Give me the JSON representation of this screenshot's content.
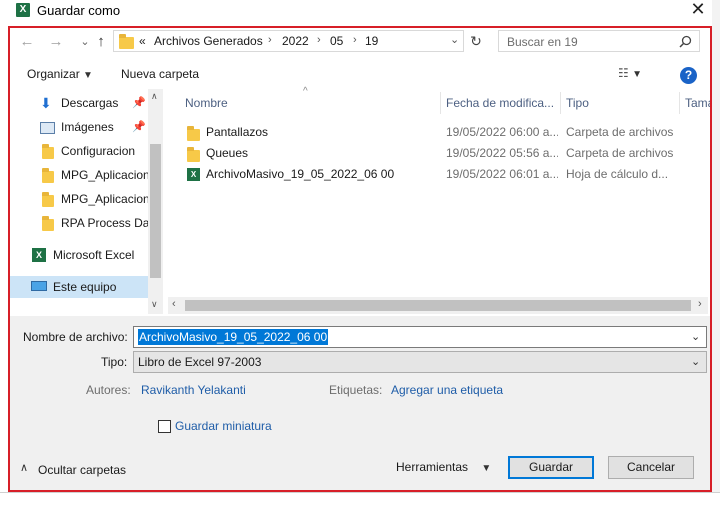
{
  "window": {
    "title": "Guardar como",
    "app_badge": "X",
    "close_icon": "close-icon"
  },
  "address": {
    "overflow": "«",
    "crumbs": [
      "Archivos Generados",
      "2022",
      "05",
      "19"
    ],
    "search_placeholder": "Buscar en 19"
  },
  "toolbar": {
    "organize": "Organizar",
    "new_folder": "Nueva carpeta",
    "help": "?"
  },
  "nav": {
    "items": [
      {
        "label": "Descargas",
        "icon": "download-icon",
        "pinned": true
      },
      {
        "label": "Imágenes",
        "icon": "pictures-icon",
        "pinned": true
      },
      {
        "label": "Configuracion",
        "icon": "folder-icon",
        "pinned": false
      },
      {
        "label": "MPG_Aplicacion",
        "icon": "folder-icon",
        "pinned": false
      },
      {
        "label": "MPG_Aplicacion",
        "icon": "folder-icon",
        "pinned": false
      },
      {
        "label": "RPA Process Dat",
        "icon": "folder-icon",
        "pinned": false
      },
      {
        "label": "Microsoft Excel",
        "icon": "excel-icon",
        "pinned": false
      },
      {
        "label": "Este equipo",
        "icon": "computer-icon",
        "pinned": false,
        "selected": true
      }
    ]
  },
  "columns": {
    "name": "Nombre",
    "modified": "Fecha de modifica...",
    "type": "Tipo",
    "size": "Tama"
  },
  "files": [
    {
      "name": "Pantallazos",
      "modified": "19/05/2022 06:00 a...",
      "type": "Carpeta de archivos",
      "icon": "folder-icon"
    },
    {
      "name": "Queues",
      "modified": "19/05/2022 05:56 a...",
      "type": "Carpeta de archivos",
      "icon": "folder-icon"
    },
    {
      "name": "ArchivoMasivo_19_05_2022_06 00",
      "modified": "19/05/2022 06:01 a...",
      "type": "Hoja de cálculo d...",
      "icon": "excel-file-icon"
    }
  ],
  "form": {
    "filename_label": "Nombre de archivo:",
    "filename_value": "ArchivoMasivo_19_05_2022_06 00",
    "type_label": "Tipo:",
    "type_value": "Libro de Excel 97-2003",
    "authors_label": "Autores:",
    "authors_value": "Ravikanth Yelakanti",
    "tags_label": "Etiquetas:",
    "tags_value": "Agregar una etiqueta",
    "thumbnail_label": "Guardar miniatura"
  },
  "footer": {
    "hide_folders": "Ocultar carpetas",
    "tools": "Herramientas",
    "save": "Guardar",
    "cancel": "Cancelar"
  },
  "colors": {
    "accent": "#0078d7",
    "highlight_frame": "#d71f28",
    "excel_green": "#1e7145",
    "selection": "#cce4f7"
  }
}
